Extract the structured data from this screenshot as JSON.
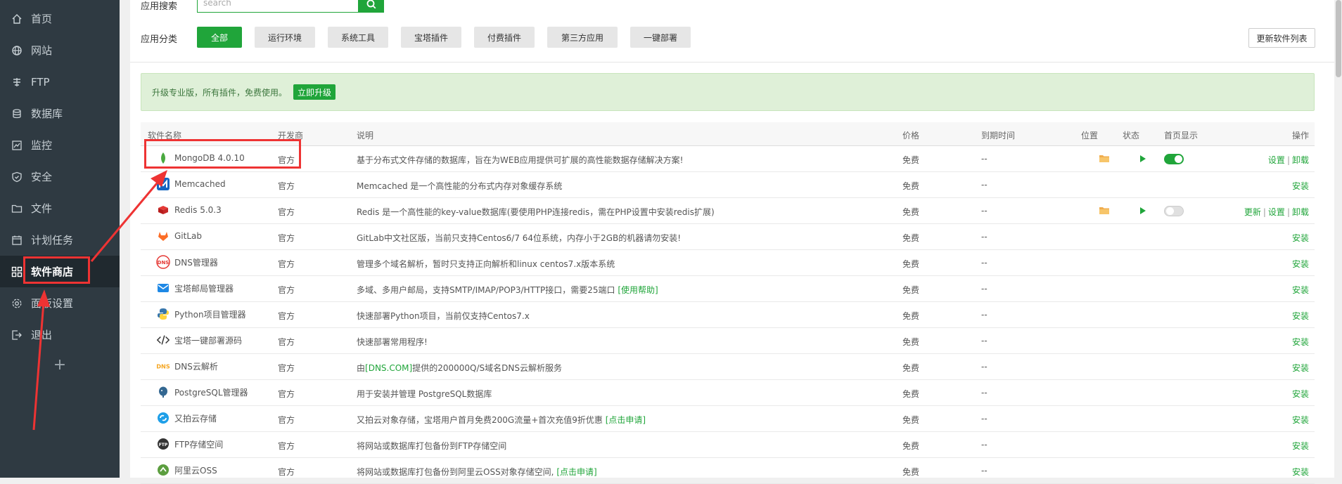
{
  "sidebar": {
    "items": [
      {
        "label": "首页",
        "icon": "home-icon"
      },
      {
        "label": "网站",
        "icon": "globe-icon"
      },
      {
        "label": "FTP",
        "icon": "ftp-icon"
      },
      {
        "label": "数据库",
        "icon": "database-icon"
      },
      {
        "label": "监控",
        "icon": "monitor-icon"
      },
      {
        "label": "安全",
        "icon": "shield-icon"
      },
      {
        "label": "文件",
        "icon": "folder-icon"
      },
      {
        "label": "计划任务",
        "icon": "calendar-icon"
      },
      {
        "label": "软件商店",
        "icon": "apps-icon",
        "active": true
      },
      {
        "label": "面板设置",
        "icon": "gear-icon"
      },
      {
        "label": "退出",
        "icon": "logout-icon"
      }
    ],
    "add_label": "+"
  },
  "toolbar": {
    "search_label": "应用搜索",
    "search_placeholder": "search",
    "category_label": "应用分类",
    "categories": [
      "全部",
      "运行环境",
      "系统工具",
      "宝塔插件",
      "付费插件",
      "第三方应用",
      "一键部署"
    ],
    "refresh_label": "更新软件列表"
  },
  "promo": {
    "text": "升级专业版，所有插件，免费使用。",
    "button": "立即升级"
  },
  "table": {
    "headers": [
      "软件名称",
      "开发商",
      "说明",
      "价格",
      "到期时间",
      "位置",
      "状态",
      "首页显示",
      "操作"
    ],
    "rows": [
      {
        "name": "MongoDB 4.0.10",
        "vendor": "官方",
        "desc": "基于分布式文件存储的数据库，旨在为WEB应用提供可扩展的高性能数据存储解决方案!",
        "link": "",
        "price": "免费",
        "expire": "--",
        "installed": true,
        "toggle_on": true,
        "ops": [
          "设置",
          "卸载"
        ]
      },
      {
        "name": "Memcached",
        "vendor": "官方",
        "desc": "Memcached 是一个高性能的分布式内存对象缓存系统",
        "link": "",
        "price": "免费",
        "expire": "--",
        "installed": false,
        "ops": [
          "安装"
        ]
      },
      {
        "name": "Redis 5.0.3",
        "vendor": "官方",
        "desc": "Redis 是一个高性能的key-value数据库(要使用PHP连接redis，需在PHP设置中安装redis扩展)",
        "link": "",
        "price": "免费",
        "expire": "--",
        "installed": true,
        "toggle_on": false,
        "ops": [
          "更新",
          "设置",
          "卸载"
        ]
      },
      {
        "name": "GitLab",
        "vendor": "官方",
        "desc": "GitLab中文社区版，当前只支持Centos6/7 64位系统，内存小于2GB的机器请勿安装!",
        "link": "",
        "price": "免费",
        "expire": "--",
        "installed": false,
        "ops": [
          "安装"
        ]
      },
      {
        "name": "DNS管理器",
        "vendor": "官方",
        "desc": "管理多个域名解析，暂时只支持正向解析和linux centos7.x版本系统",
        "link": "",
        "price": "免费",
        "expire": "--",
        "installed": false,
        "ops": [
          "安装"
        ]
      },
      {
        "name": "宝塔邮局管理器",
        "vendor": "官方",
        "desc": "多域、多用户邮局，支持SMTP/IMAP/POP3/HTTP接口，需要25端口 ",
        "link": "[使用帮助]",
        "price": "免费",
        "expire": "--",
        "installed": false,
        "ops": [
          "安装"
        ]
      },
      {
        "name": "Python项目管理器",
        "vendor": "官方",
        "desc": "快速部署Python项目，当前仅支持Centos7.x",
        "link": "",
        "price": "免费",
        "expire": "--",
        "installed": false,
        "ops": [
          "安装"
        ]
      },
      {
        "name": "宝塔一键部署源码",
        "vendor": "官方",
        "desc": "快速部署常用程序!",
        "link": "",
        "price": "免费",
        "expire": "--",
        "installed": false,
        "ops": [
          "安装"
        ]
      },
      {
        "name": "DNS云解析",
        "vendor": "官方",
        "desc_pre": "由",
        "link_mid": "[DNS.COM]",
        "desc": "提供的200000Q/S域名DNS云解析服务",
        "link": "",
        "price": "免费",
        "expire": "--",
        "installed": false,
        "ops": [
          "安装"
        ]
      },
      {
        "name": "PostgreSQL管理器",
        "vendor": "官方",
        "desc": "用于安装并管理 PostgreSQL数据库",
        "link": "",
        "price": "免费",
        "expire": "--",
        "installed": false,
        "ops": [
          "安装"
        ]
      },
      {
        "name": "又拍云存储",
        "vendor": "官方",
        "desc": "又拍云对象存储，宝塔用户首月免费200G流量+首次充值9折优惠 ",
        "link": "[点击申请]",
        "price": "免费",
        "expire": "--",
        "installed": false,
        "ops": [
          "安装"
        ]
      },
      {
        "name": "FTP存储空间",
        "vendor": "官方",
        "desc": "将网站或数据库打包备份到FTP存储空间",
        "link": "",
        "price": "免费",
        "expire": "--",
        "installed": false,
        "ops": [
          "安装"
        ]
      },
      {
        "name": "阿里云OSS",
        "vendor": "官方",
        "desc": "将网站或数据库打包备份到阿里云OSS对象存储空间, ",
        "link": "[点击申请]",
        "price": "免费",
        "expire": "--",
        "installed": false,
        "ops": [
          "安装"
        ]
      }
    ]
  },
  "colors": {
    "accent": "#20a53a",
    "annotation": "#e33333",
    "sidebar": "#2f3a42"
  }
}
